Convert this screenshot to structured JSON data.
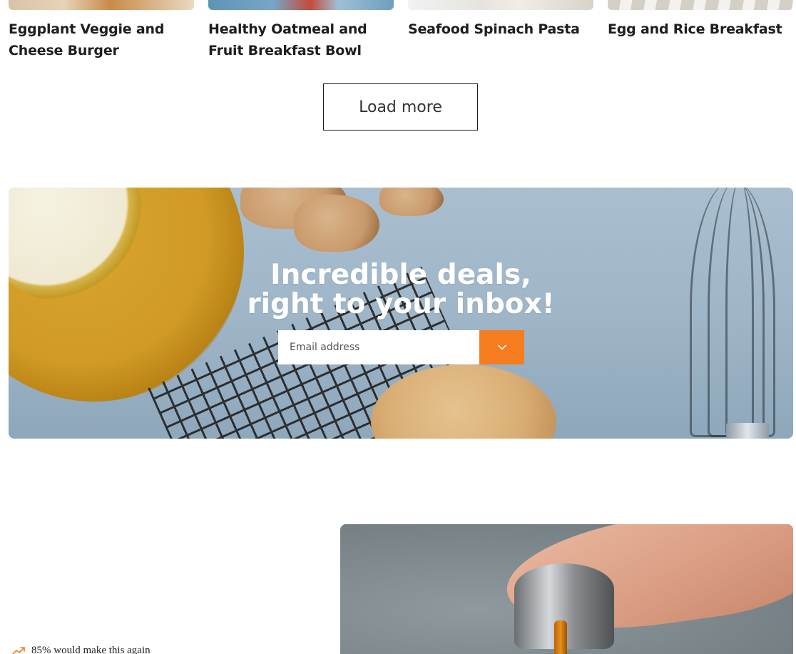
{
  "recipes": [
    {
      "title": "Eggplant Veggie and Cheese Burger"
    },
    {
      "title": "Healthy Oatmeal and Fruit Breakfast Bowl"
    },
    {
      "title": "Seafood Spinach Pasta"
    },
    {
      "title": "Egg and Rice Breakfast"
    }
  ],
  "load_more": {
    "label": "Load more"
  },
  "newsletter": {
    "title_line1": "Incredible deals,",
    "title_line2": "right to your inbox!",
    "email_placeholder": "Email address",
    "submit_icon": "chevron-down-icon"
  },
  "stat": {
    "icon": "trending-up-icon",
    "text": "85% would make this again"
  },
  "colors": {
    "accent": "#f57d20"
  }
}
